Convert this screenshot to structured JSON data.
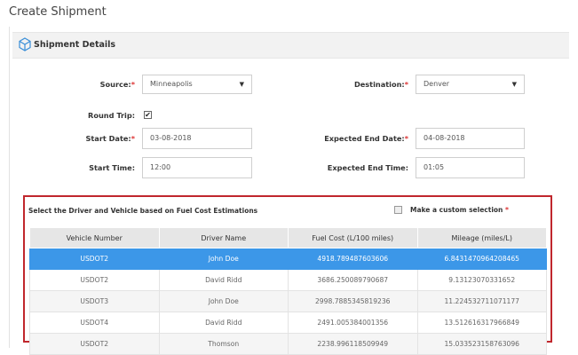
{
  "page": {
    "title": "Create Shipment"
  },
  "panel": {
    "title": "Shipment Details"
  },
  "form": {
    "source": {
      "label": "Source:",
      "value": "Minneapolis"
    },
    "destination": {
      "label": "Destination:",
      "value": "Denver"
    },
    "round_trip": {
      "label": "Round Trip:",
      "checked": true
    },
    "start_date": {
      "label": "Start Date:",
      "value": "03-08-2018"
    },
    "expected_end_date": {
      "label": "Expected End Date:",
      "value": "04-08-2018"
    },
    "start_time": {
      "label": "Start Time:",
      "value": "12:00"
    },
    "expected_end_time": {
      "label": "Expected End Time:",
      "value": "01:05"
    },
    "required_mark": "*",
    "checkmark": "✔",
    "caret": "▼"
  },
  "selection": {
    "title": "Select the Driver and Vehicle based on Fuel Cost Estimations",
    "custom_label": "Make a custom selection",
    "columns": [
      "Vehicle Number",
      "Driver Name",
      "Fuel Cost (L/100 miles)",
      "Mileage (miles/L)"
    ],
    "rows": [
      [
        "USDOT2",
        "John Doe",
        "4918.789487603606",
        "6.8431470964208465"
      ],
      [
        "USDOT2",
        "David Ridd",
        "3686.250089790687",
        "9.13123070331652"
      ],
      [
        "USDOT3",
        "John Doe",
        "2998.7885345819236",
        "11.224532711071177"
      ],
      [
        "USDOT4",
        "David Ridd",
        "2491.005384001356",
        "13.512616317966849"
      ],
      [
        "USDOT2",
        "Thomson",
        "2238.996118509949",
        "15.033523158763096"
      ]
    ],
    "selected_row": 0
  },
  "colors": {
    "accent": "#3c97e8",
    "highlight_border": "#c0272d",
    "required": "#dd3333"
  }
}
